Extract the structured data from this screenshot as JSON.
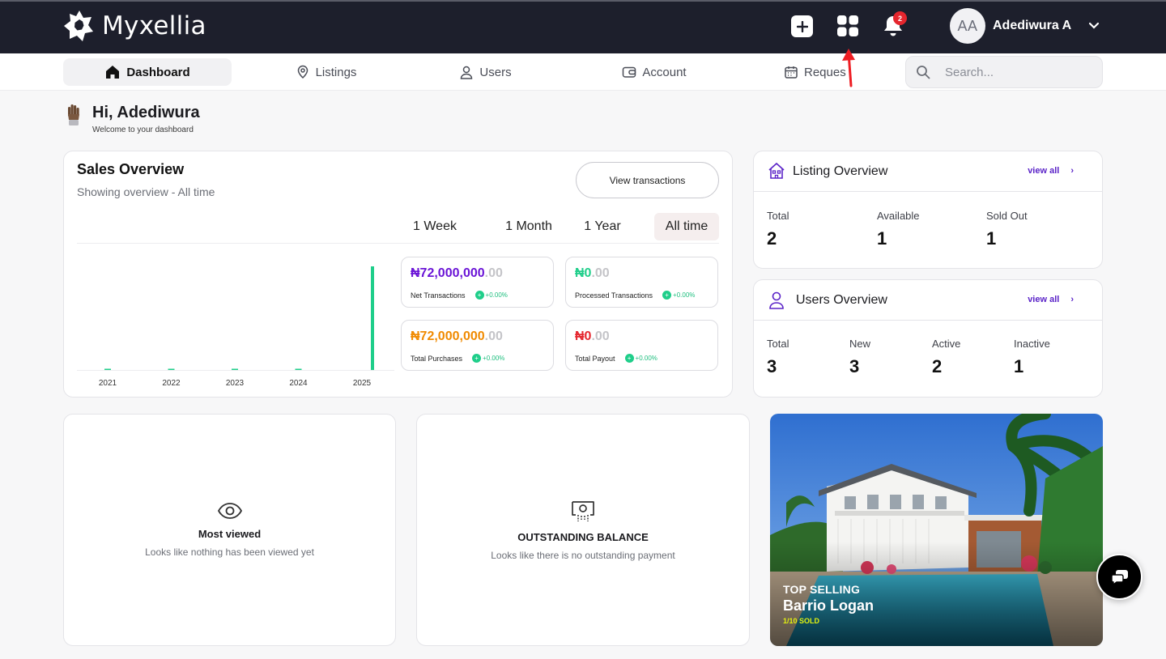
{
  "app": {
    "brand": "Myxellia"
  },
  "header": {
    "notification_count": "2",
    "user": {
      "initials": "AA",
      "name": "Adediwura A"
    }
  },
  "nav": {
    "items": [
      {
        "label": "Dashboard",
        "icon": "home-icon"
      },
      {
        "label": "Listings",
        "icon": "map-pin-icon"
      },
      {
        "label": "Users",
        "icon": "user-icon"
      },
      {
        "label": "Account",
        "icon": "wallet-icon"
      },
      {
        "label": "Reques",
        "icon": "calendar-icon"
      }
    ],
    "active": "Dashboard",
    "search_placeholder": "Search..."
  },
  "greeting": {
    "title": "Hi, Adediwura",
    "subtitle": "Welcome to your dashboard"
  },
  "sales": {
    "title": "Sales Overview",
    "subtitle": "Showing overview - All time",
    "view_button": "View transactions",
    "periods": [
      "1 Week",
      "1 Month",
      "1 Year",
      "All time"
    ],
    "active_period": "All time",
    "stats": [
      {
        "amount": "₦72,000,000",
        "decimals": ".00",
        "label": "Net Transactions",
        "change": "+0.00%",
        "color": "#6a14d6"
      },
      {
        "amount": "₦0",
        "decimals": ".00",
        "label": "Processed Transactions",
        "change": "+0.00%",
        "color": "#1fce8a"
      },
      {
        "amount": "₦72,000,000",
        "decimals": ".00",
        "label": "Total Purchases",
        "change": "+0.00%",
        "color": "#f08a00"
      },
      {
        "amount": "₦0",
        "decimals": ".00",
        "label": "Total Payout",
        "change": "+0.00%",
        "color": "#e5262e"
      }
    ]
  },
  "chart_data": {
    "type": "bar",
    "categories": [
      "2021",
      "2022",
      "2023",
      "2024",
      "2025"
    ],
    "values": [
      0,
      0,
      0,
      0,
      72000000
    ],
    "title": "",
    "xlabel": "",
    "ylabel": "",
    "grid": false,
    "bar_color": "#1fce8a"
  },
  "listing_overview": {
    "title": "Listing Overview",
    "link": "view all",
    "metrics": [
      {
        "label": "Total",
        "value": "2"
      },
      {
        "label": "Available",
        "value": "1"
      },
      {
        "label": "Sold Out",
        "value": "1"
      }
    ]
  },
  "users_overview": {
    "title": "Users Overview",
    "link": "view all",
    "metrics": [
      {
        "label": "Total",
        "value": "3"
      },
      {
        "label": "New",
        "value": "3"
      },
      {
        "label": "Active",
        "value": "2"
      },
      {
        "label": "Inactive",
        "value": "1"
      }
    ]
  },
  "most_viewed": {
    "title": "Most viewed",
    "subtitle": "Looks like nothing has been viewed yet"
  },
  "outstanding": {
    "title": "OUTSTANDING BALANCE",
    "subtitle": "Looks like there is no outstanding payment"
  },
  "promo": {
    "tag": "TOP SELLING",
    "name": "Barrio Logan",
    "sold": "1/10 SOLD"
  }
}
